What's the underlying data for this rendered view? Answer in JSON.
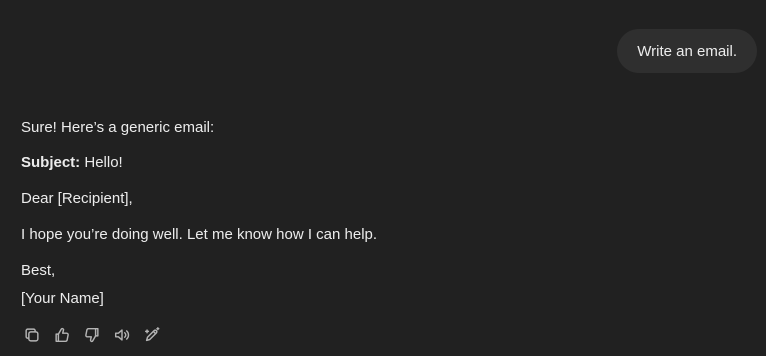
{
  "user_message": {
    "text": "Write an email."
  },
  "assistant_message": {
    "intro": "Sure! Here’s a generic email:",
    "subject_label": "Subject:",
    "subject_value": " Hello!",
    "greeting": "Dear [Recipient],",
    "body": "I hope you’re doing well. Let me know how I can help.",
    "signoff": "Best,",
    "signature": "[Your Name]"
  },
  "actions": [
    {
      "name": "copy",
      "icon": "copy-icon"
    },
    {
      "name": "good-response",
      "icon": "thumbs-up-icon"
    },
    {
      "name": "bad-response",
      "icon": "thumbs-down-icon"
    },
    {
      "name": "read-aloud",
      "icon": "speaker-icon"
    },
    {
      "name": "edit",
      "icon": "pencil-sparkle-icon"
    }
  ]
}
